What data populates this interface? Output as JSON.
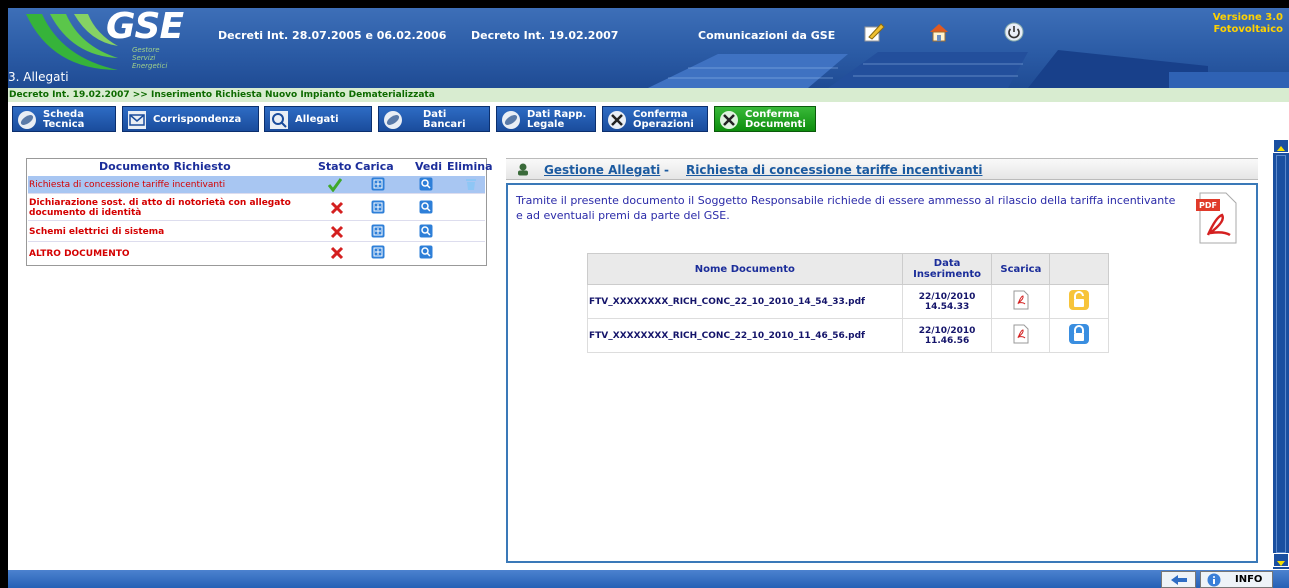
{
  "header": {
    "logo_text": "GSE",
    "logo_sub": [
      "Gestore",
      "Servizi",
      "Energetici"
    ],
    "links": [
      "Decreti Int. 28.07.2005 e 06.02.2006",
      "Decreto Int. 19.02.2007",
      "Comunicazioni da GSE"
    ],
    "version_line1": "Versione 3.0",
    "version_line2": "Fotovoltaico",
    "section": "3. Allegati"
  },
  "breadcrumb": "Decreto Int. 19.02.2007 >> Inserimento Richiesta Nuovo Impianto Dematerializzata",
  "tabs": [
    {
      "line1": "Scheda",
      "line2": "Tecnica"
    },
    {
      "line1": "Corrispondenza",
      "line2": ""
    },
    {
      "line1": "Allegati",
      "line2": ""
    },
    {
      "line1": "Dati",
      "line2": "Bancari"
    },
    {
      "line1": "Dati Rapp.",
      "line2": "Legale"
    },
    {
      "line1": "Conferma",
      "line2": "Operazioni"
    },
    {
      "line1": "Conferma",
      "line2": "Documenti"
    }
  ],
  "documents": {
    "headers": {
      "doc": "Documento Richiesto",
      "stato": "Stato",
      "carica": "Carica",
      "vedi": "Vedi",
      "elimina": "Elimina"
    },
    "rows": [
      {
        "label": "Richiesta di concessione tariffe incentivanti",
        "status": "ok"
      },
      {
        "label": "Dichiarazione sost. di atto di notorietà con allegato documento di identità",
        "status": "missing"
      },
      {
        "label": "Schemi elettrici di sistema",
        "status": "missing"
      },
      {
        "label": "ALTRO DOCUMENTO",
        "status": "missing"
      }
    ]
  },
  "right_panel": {
    "title_left": "Gestione Allegati",
    "title_sep": "-",
    "title_right": "Richiesta di concessione tariffe incentivanti",
    "description": "Tramite il presente documento il Soggetto Responsabile richiede di essere ammesso al rilascio della tariffa incentivante e ad eventuali premi da parte del GSE.",
    "pdf_label": "PDF",
    "table": {
      "headers": {
        "name": "Nome Documento",
        "date_1": "Data",
        "date_2": "Inserimento",
        "download": "Scarica"
      },
      "rows": [
        {
          "name": "FTV_XXXXXXXX_RICH_CONC_22_10_2010_14_54_33.pdf",
          "date": "22/10/2010",
          "time": "14.54.33",
          "lock": "unlocked"
        },
        {
          "name": "FTV_XXXXXXXX_RICH_CONC_22_10_2010_11_46_56.pdf",
          "date": "22/10/2010",
          "time": "11.46.56",
          "lock": "locked"
        }
      ]
    }
  },
  "footer": {
    "info_label": "INFO"
  },
  "colors": {
    "header_blue": "#2a5aa4",
    "label_red": "#d40000",
    "tab_green": "#1aa01a",
    "link_blue": "#1b2d9a"
  },
  "icons": [
    "edit-icon",
    "home-icon",
    "power-icon",
    "pdf-icon",
    "lock-icon",
    "back-arrow-icon",
    "info-icon"
  ]
}
